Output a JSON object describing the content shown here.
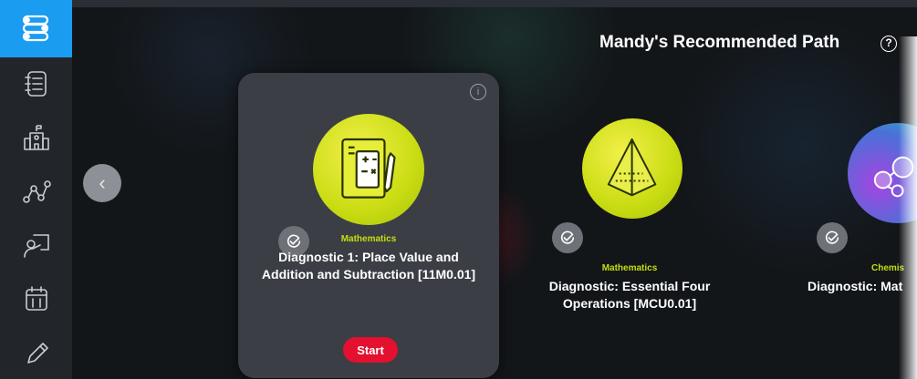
{
  "sidebar": {
    "items": [
      {
        "icon": "path-icon",
        "active": true
      },
      {
        "icon": "notebook-icon",
        "active": false
      },
      {
        "icon": "school-icon",
        "active": false
      },
      {
        "icon": "network-icon",
        "active": false
      },
      {
        "icon": "teacher-board-icon",
        "active": false
      },
      {
        "icon": "calendar-icon",
        "active": false
      },
      {
        "icon": "pencil-icon",
        "active": false
      }
    ]
  },
  "header": {
    "title": "Mandy's Recommended Path",
    "help_symbol": "?"
  },
  "carousel": {
    "prev_symbol": "‹",
    "cards": [
      {
        "subject": "Mathematics",
        "title": "Diagnostic 1: Place Value and Addition and Subtraction [11M0.01]",
        "button": "Start",
        "info_symbol": "i",
        "icon": "math-worksheet-icon"
      },
      {
        "subject": "Mathematics",
        "title": "Diagnostic: Essential Four Operations [MCU0.01]",
        "icon": "pyramid-icon"
      },
      {
        "subject": "Chemis",
        "title": "Diagnostic: Mat",
        "icon": "molecule-icon"
      }
    ]
  },
  "colors": {
    "accent": "#1a9cf0",
    "subject": "#c5df10",
    "start_button": "#e3102f"
  }
}
